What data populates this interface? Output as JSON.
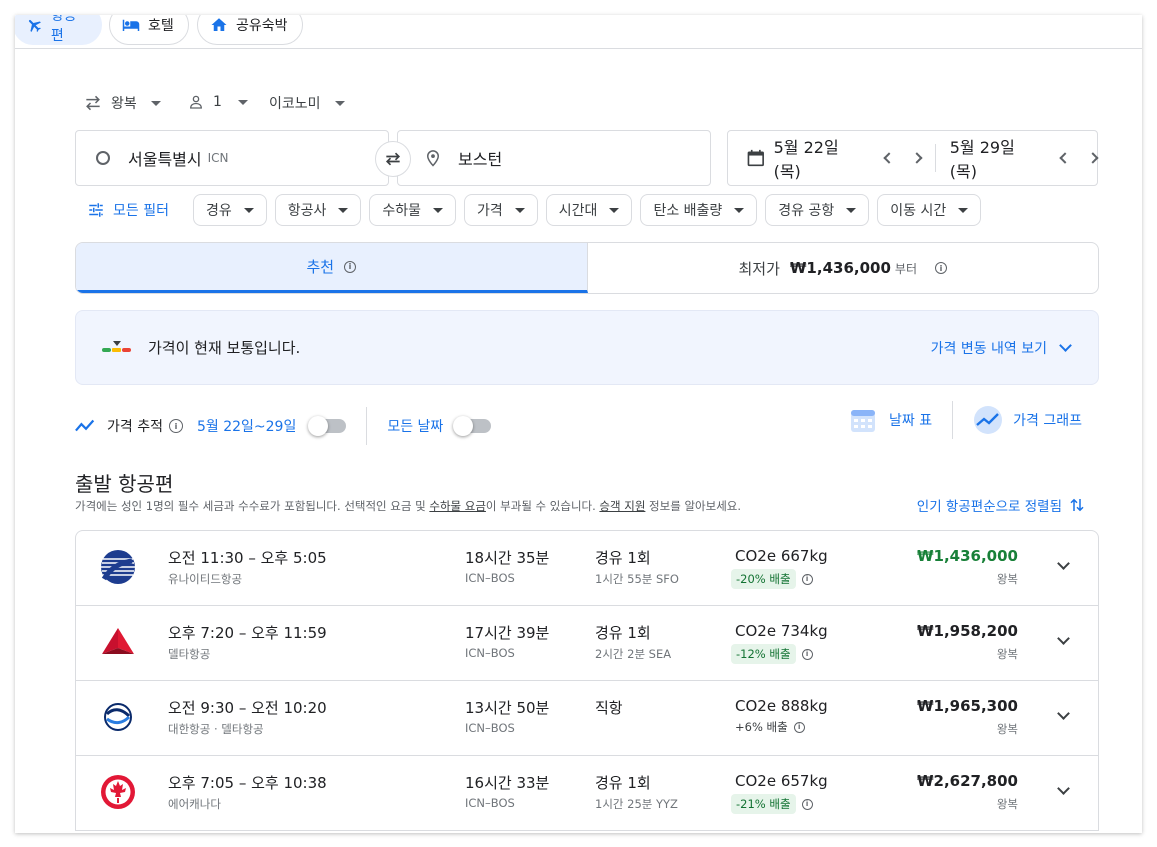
{
  "top_tabs": [
    {
      "label": "항공편",
      "icon": "airplane-icon"
    },
    {
      "label": "호텔",
      "icon": "bed-icon"
    },
    {
      "label": "공유숙박",
      "icon": "house-icon"
    }
  ],
  "trip": {
    "type": "왕복",
    "passengers": "1",
    "cabin": "이코노미"
  },
  "search": {
    "origin": "서울특별시",
    "origin_code": "ICN",
    "destination": "보스턴",
    "depart_date": "5월 22일 (목)",
    "return_date": "5월 29일 (목)"
  },
  "filters": {
    "all_label": "모든 필터",
    "chips": [
      "경유",
      "항공사",
      "수하물",
      "가격",
      "시간대",
      "탄소 배출량",
      "경유 공항",
      "이동 시간"
    ]
  },
  "sort_tabs": {
    "recommended": "추천",
    "cheapest_label": "최저가",
    "cheapest_price": "₩1,436,000",
    "cheapest_suffix": "부터"
  },
  "insight": {
    "message": "가격이 현재 보통입니다.",
    "history_link": "가격 변동 내역 보기"
  },
  "tracking": {
    "label": "가격 추적",
    "date_range": "5월 22일~29일",
    "all_dates": "모든 날짜",
    "date_grid": "날짜 표",
    "price_graph": "가격 그래프"
  },
  "departures": {
    "title": "출발 항공편",
    "note_1": "가격에는 성인 1명의 필수 세금과 수수료가 포함됩니다. 선택적인 요금 및 ",
    "note_baggage": "수하물 요금",
    "note_2": "이 부과될 수 있습니다. ",
    "note_assist": "승객 지원",
    "note_3": " 정보를 알아보세요.",
    "sort_label": "인기 항공편순으로 정렬됨"
  },
  "flights": [
    {
      "times": "오전 11:30 – 오후 5:05",
      "airline": "유나이티드항공",
      "duration": "18시간 35분",
      "route": "ICN–BOS",
      "stops": "경유 1회",
      "layover": "1시간 55분 SFO",
      "co2": "CO2e 667kg",
      "emission": "-20% 배출",
      "price": "₩1,436,000",
      "price_type": "왕복",
      "logo": "united-logo-icon"
    },
    {
      "times": "오후 7:20 – 오후 11:59",
      "airline": "델타항공",
      "duration": "17시간 39분",
      "route": "ICN–BOS",
      "stops": "경유 1회",
      "layover": "2시간 2분 SEA",
      "co2": "CO2e 734kg",
      "emission": "-12% 배출",
      "price": "₩1,958,200",
      "price_type": "왕복",
      "logo": "delta-logo-icon"
    },
    {
      "times": "오전 9:30 – 오전 10:20",
      "airline": "대한항공 · 델타항공",
      "duration": "13시간 50분",
      "route": "ICN–BOS",
      "stops": "직항",
      "layover": "",
      "co2": "CO2e 888kg",
      "emission": "+6% 배출",
      "price": "₩1,965,300",
      "price_type": "왕복",
      "logo": "korean-air-logo-icon"
    },
    {
      "times": "오후 7:05 – 오후 10:38",
      "airline": "에어캐나다",
      "duration": "16시간 33분",
      "route": "ICN–BOS",
      "stops": "경유 1회",
      "layover": "1시간 25분 YYZ",
      "co2": "CO2e 657kg",
      "emission": "-21% 배출",
      "price": "₩2,627,800",
      "price_type": "왕복",
      "logo": "air-canada-logo-icon"
    }
  ],
  "colors": {
    "accent": "#1a73e8",
    "best_price": "#188038",
    "low_emission_bg": "#e6f4ea"
  }
}
